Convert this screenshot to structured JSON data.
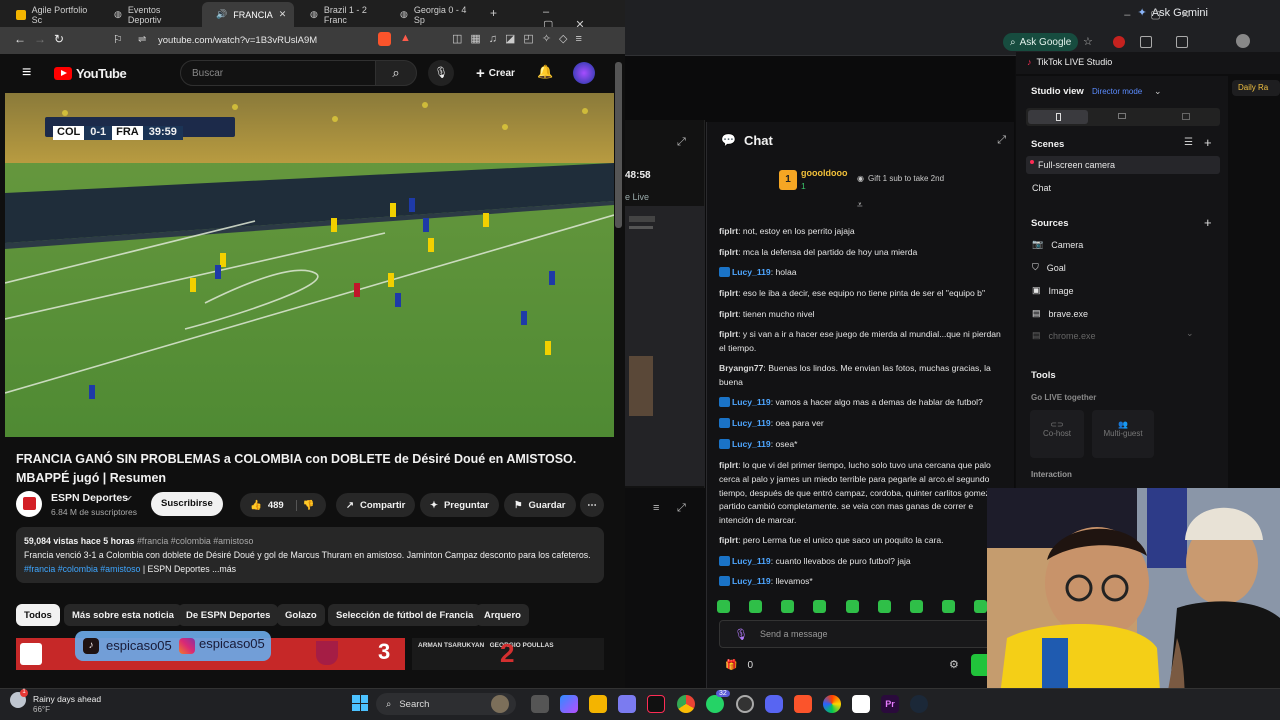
{
  "gemini": {
    "label": "Ask Gemini"
  },
  "google": {
    "ask": "Ask Google"
  },
  "tiktok_left": {
    "time": "48:58",
    "live": "e Live"
  },
  "chat": {
    "title": "Chat",
    "top_gifter": {
      "name": "goooldooo",
      "count": "1",
      "rank": "1"
    },
    "gift_hint": "Gift 1 sub to take 2nd",
    "partial_first": "fiplrt: ...",
    "messages": [
      {
        "user": "fiplrt",
        "text": "not, estoy en los perrito jajaja",
        "blue": false
      },
      {
        "user": "fiplrt",
        "text": "mca la defensa del partido de hoy una mierda",
        "blue": false
      },
      {
        "user": "Lucy_119",
        "text": "holaa",
        "blue": true
      },
      {
        "user": "fiplrt",
        "text": "eso le iba a decir, ese equipo no tiene pinta de ser el \"equipo b\"",
        "blue": false
      },
      {
        "user": "fiplrt",
        "text": "tienen mucho nivel",
        "blue": false
      },
      {
        "user": "fiplrt",
        "text": "y si van a ir a hacer ese juego de mierda al mundial...que ni pierdan el tiempo.",
        "blue": false
      },
      {
        "user": "Bryangn77",
        "text": "Buenas los lindos. Me envian las fotos, muchas gracias, la buena",
        "blue": false
      },
      {
        "user": "Lucy_119",
        "text": "vamos a hacer algo mas a demas de hablar de futbol?",
        "blue": true
      },
      {
        "user": "Lucy_119",
        "text": "oea para ver",
        "blue": true
      },
      {
        "user": "Lucy_119",
        "text": "osea*",
        "blue": true
      },
      {
        "user": "fiplrt",
        "text": "lo que vi del primer tiempo, lucho solo tuvo una cercana que palo cerca al palo y james un miedo terrible para pegarle al arco.el segundo tiempo, después de que entró campaz, cordoba, quinter carlitos gomez el partido cambió completamente. se veia con mas ganas de correr e intención de marcar.",
        "blue": false
      },
      {
        "user": "fiplrt",
        "text": "pero Lerma fue el unico que saco un poquito la cara.",
        "blue": false
      },
      {
        "user": "Lucy_119",
        "text": "cuanto llevabos de puro futbol? jaja",
        "blue": true
      },
      {
        "user": "Lucy_119",
        "text": "llevamos*",
        "blue": true
      }
    ],
    "input_placeholder": "Send a message",
    "count": "0"
  },
  "studio": {
    "title": "TikTok LIVE Studio",
    "view_label": "Studio view",
    "mode": "Director mode",
    "daily": "Daily Ra",
    "scenes_label": "Scenes",
    "scenes": [
      "Full-screen camera",
      "Chat"
    ],
    "sources_label": "Sources",
    "sources": [
      "Camera",
      "Goal",
      "Image",
      "brave.exe",
      "chrome.exe"
    ],
    "tools_label": "Tools",
    "golive": "Go LIVE together",
    "cohost": "Co-host",
    "multiguest": "Multi-guest",
    "interaction": "Interaction"
  },
  "tabs": [
    {
      "title": "Agile Portfolio Sc",
      "active": false
    },
    {
      "title": "Eventos Deportiv",
      "active": false
    },
    {
      "title": "FRANCIA",
      "active": true
    },
    {
      "title": "Brazil 1 - 2 Franc",
      "active": false
    },
    {
      "title": "Georgia 0 - 4 Sp",
      "active": false
    }
  ],
  "address": {
    "url": "youtube.com/watch?v=1B3vRUslA9M"
  },
  "youtube": {
    "logo": "YouTube",
    "search_placeholder": "Buscar",
    "create": "Crear",
    "scoreboard": {
      "home": "COL",
      "score": "0-1",
      "away": "FRA",
      "time": "39:59"
    },
    "video_title": "FRANCIA GANÓ SIN PROBLEMAS a COLOMBIA con DOBLETE de Désiré Doué en AMISTOSO. MBAPPÉ jugó | Resumen",
    "channel": "ESPN Deportes",
    "subscribers": "6.84 M de suscriptores",
    "subscribe": "Suscribirse",
    "likes": "489",
    "share": "Compartir",
    "ask": "Preguntar",
    "save": "Guardar",
    "desc_stats": "59,084 vistas  hace 5 horas",
    "desc_tags": "#francia #colombia #amistoso",
    "desc_text": "Francia venció 3-1 a Colombia con doblete de Désiré Doué y gol de Marcus Thuram en amistoso. Jaminton Campaz desconto para los cafeteros.",
    "desc_tags2": "#francia #colombia #amistoso",
    "desc_tail": "| ESPN Deportes ...más",
    "chips": [
      "Todos",
      "Más sobre esta noticia",
      "De ESPN Deportes",
      "Golazo",
      "Selección de fútbol de Francia",
      "Arquero"
    ]
  },
  "overlay": {
    "tiktok_handle": "espicaso05",
    "ig_handle": "espicaso05"
  },
  "thumbs": {
    "badge": "3",
    "fighters": "ARMAN TSARUKYAN   GEORGIO POULLAS"
  },
  "weather": {
    "text": "Rainy days ahead",
    "temp": "66°F"
  },
  "taskbar": {
    "search": "Search",
    "badge": "32"
  }
}
